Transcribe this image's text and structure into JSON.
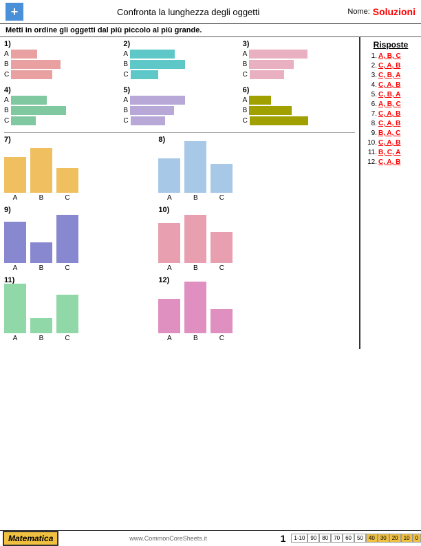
{
  "header": {
    "title": "Confronta la lunghezza degli oggetti",
    "nome_label": "Nome:",
    "solutions_label": "Soluzioni",
    "logo": "+"
  },
  "instruction": "Metti in ordine gli oggetti dal più piccolo al più grande.",
  "answers_title": "Risposte",
  "answers": [
    {
      "num": "1.",
      "val": "A, B, C"
    },
    {
      "num": "2.",
      "val": "C, A, B"
    },
    {
      "num": "3.",
      "val": "C, B, A"
    },
    {
      "num": "4.",
      "val": "C, A, B"
    },
    {
      "num": "5.",
      "val": "C, B, A"
    },
    {
      "num": "6.",
      "val": "A, B, C"
    },
    {
      "num": "7.",
      "val": "C, A, B"
    },
    {
      "num": "8.",
      "val": "C, A, B"
    },
    {
      "num": "9.",
      "val": "B, A, C"
    },
    {
      "num": "10.",
      "val": "C, A, B"
    },
    {
      "num": "11.",
      "val": "B, C, A"
    },
    {
      "num": "12.",
      "val": "C, A, B"
    }
  ],
  "footer": {
    "math_label": "Matematica",
    "url": "www.CommonCoreSheets.it",
    "page": "1",
    "scores_label": "1-10",
    "scores": [
      "90",
      "80",
      "70",
      "60",
      "50",
      "40",
      "30",
      "20",
      "10",
      "0"
    ]
  }
}
